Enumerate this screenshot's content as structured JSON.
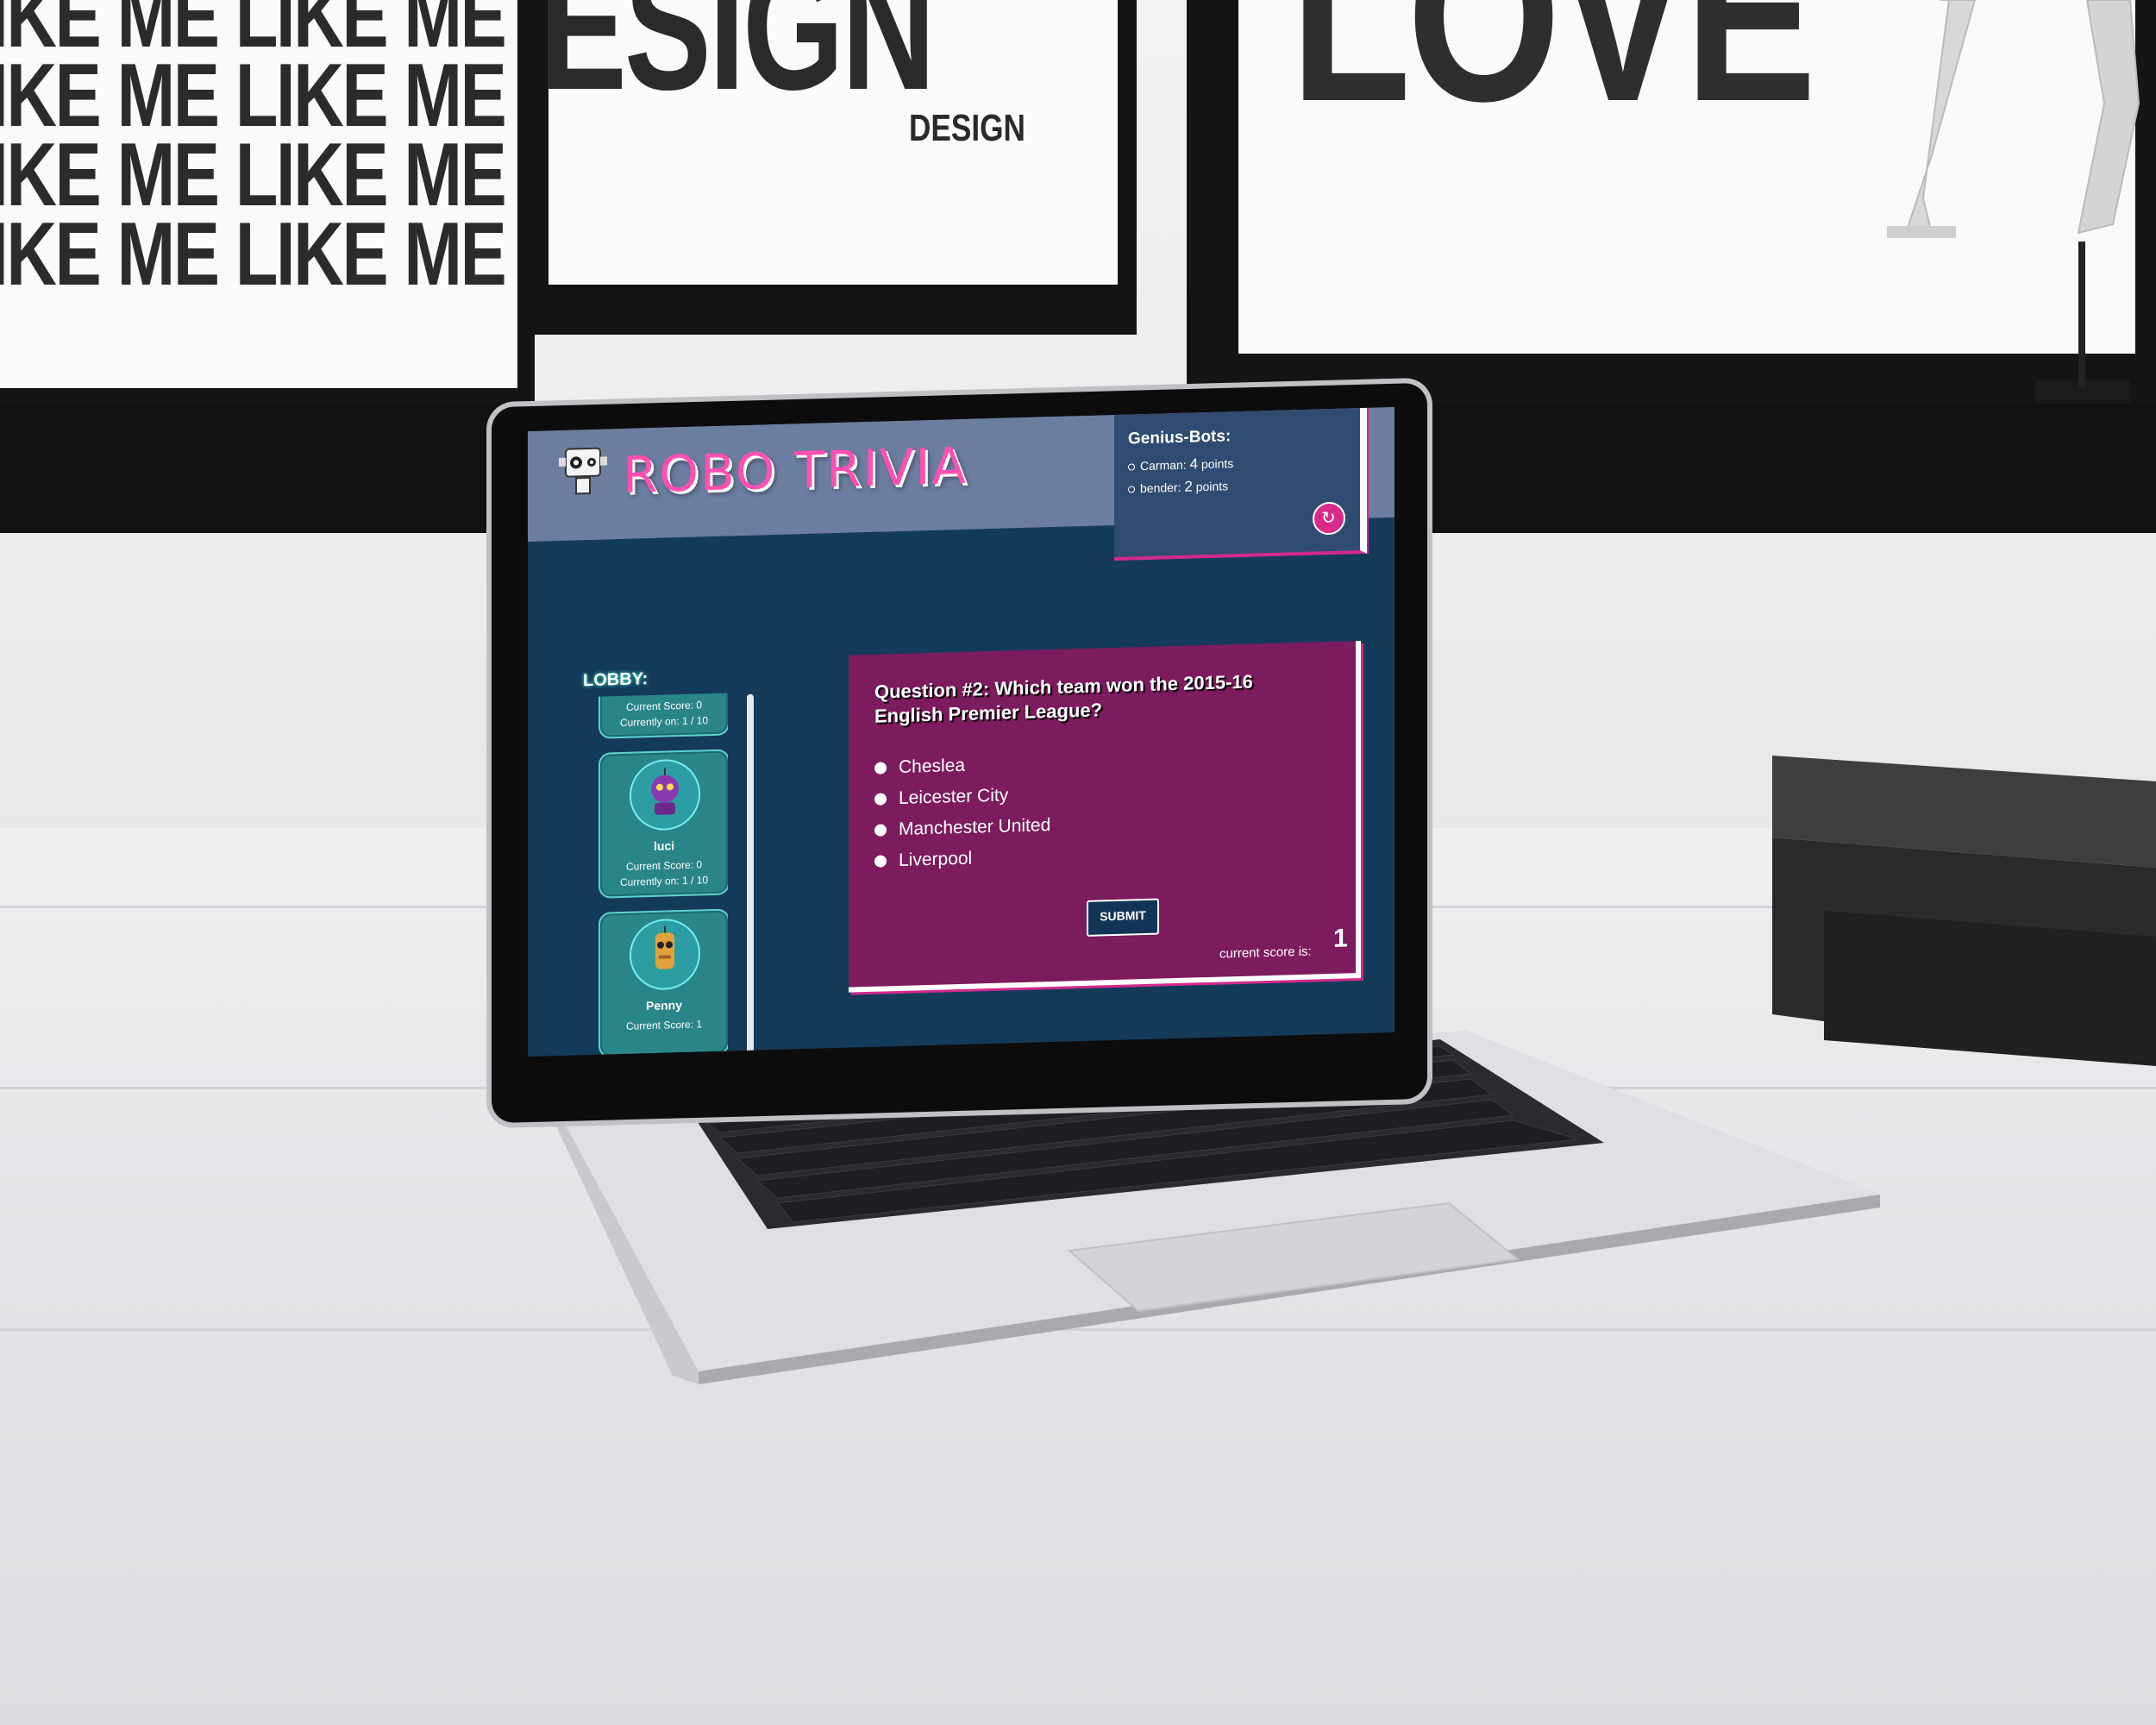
{
  "app": {
    "title": "ROBO TRIVIA"
  },
  "leaderboard": {
    "title": "Genius-Bots:",
    "entries": [
      {
        "name": "Carman:",
        "points": "4",
        "unit": "points"
      },
      {
        "name": "bender:",
        "points": "2",
        "unit": "points"
      }
    ],
    "refresh_icon": "refresh-icon"
  },
  "lobby": {
    "label": "LOBBY:",
    "players": [
      {
        "name": "",
        "score": "Current Score: 0",
        "progress": "Currently on: 1 / 10"
      },
      {
        "name": "luci",
        "score": "Current Score: 0",
        "progress": "Currently on: 1 / 10"
      },
      {
        "name": "Penny",
        "score": "Current Score: 1",
        "progress": ""
      }
    ]
  },
  "question": {
    "text": "Question #2: Which team won the 2015-16 English Premier League?",
    "options": [
      "Cheslea",
      "Leicester City",
      "Manchester United",
      "Liverpool"
    ],
    "submit_label": "SUBMIT",
    "score_label": "current score is:",
    "score_value": "1"
  },
  "scene": {
    "poster_left_text": "LIKE ME LIKE ME",
    "poster_middle_big": "ESIGN",
    "poster_middle_small": "DESIGN",
    "poster_right_big": "LOVE"
  },
  "colors": {
    "accent_pink": "#d82a8a",
    "question_bg": "#7c1b5d",
    "screen_bg": "#143a5a",
    "card_teal": "#2a8589"
  }
}
